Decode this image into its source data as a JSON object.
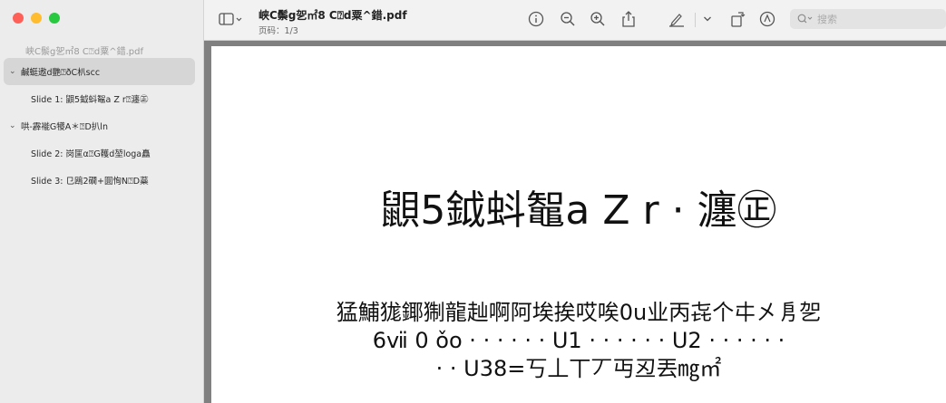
{
  "window": {
    "filename": "峡C鬃g乫㎡8 C⍰d粟^錯.pdf",
    "page_indicator": "页码：1/3"
  },
  "sidebar": {
    "file_label": "峡C鬃g乫㎡8 C⍰d粟^錯.pdf",
    "items": [
      {
        "label": "鹹蜓遨d艷⍰ðC朳scc",
        "type": "section"
      },
      {
        "label": "Slide 1: 鼰5鉞蚪鼅a Z r⍰瀍㊣",
        "type": "child"
      },
      {
        "label": "哄-霹褦G犪A＊⍰D扒ln",
        "type": "section"
      },
      {
        "label": "Slide 2: 岗匩α⍰G韄d堃loga矗",
        "type": "child"
      },
      {
        "label": "Slide 3: 㔾鴎2礀+圎恂N⍰D蘂",
        "type": "child"
      }
    ]
  },
  "toolbar": {
    "search_placeholder": "搜索"
  },
  "slide": {
    "title": "鼰5鉞蚪鼅a Z r · 瀍㊣",
    "body_lines": [
      "猛鯆狵鎁猘龍赸啊阿埃挨哎唉0u业丙㐂个㐄㐅㐆乫",
      "6ⅶ 0 ǒo · · · · · · U1 · · · · · · U2 · · · · · ·",
      "· · U38=丂丄丅丆丏丒丟㎎㎡"
    ]
  }
}
